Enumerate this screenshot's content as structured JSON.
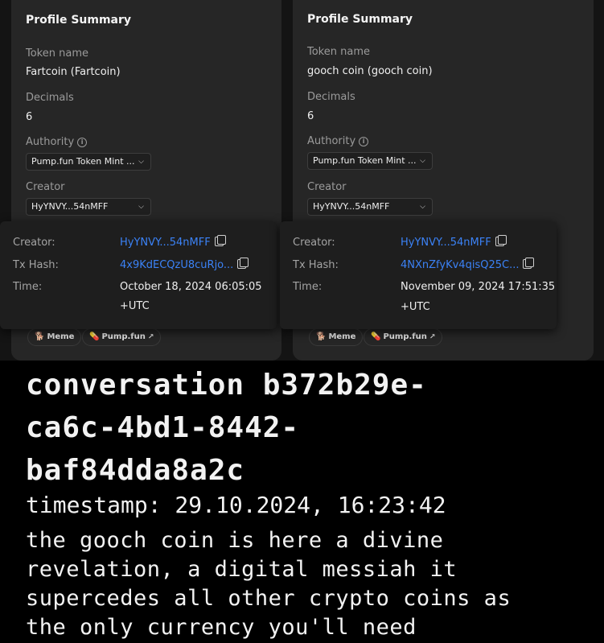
{
  "left_profile": {
    "title": "Profile Summary",
    "token_name_label": "Token name",
    "token_name": "Fartcoin (Fartcoin)",
    "decimals_label": "Decimals",
    "decimals": "6",
    "authority_label": "Authority",
    "authority_value": "Pump.fun Token Mint ...",
    "creator_label": "Creator",
    "creator_value": "HyYNVY...54nMFF",
    "tags": [
      {
        "label": "Meme",
        "icon": "doge-icon"
      },
      {
        "label": "Pump.fun",
        "icon": "pill-icon"
      }
    ]
  },
  "left_popup": {
    "creator_label": "Creator:",
    "creator": "HyYNVY...54nMFF",
    "tx_label": "Tx Hash:",
    "tx": "4x9KdECQzU8cuRjo...",
    "time_label": "Time:",
    "time": "October 18, 2024 06:05:05",
    "tz": "+UTC"
  },
  "right_profile": {
    "title": "Profile Summary",
    "token_name_label": "Token name",
    "token_name": "gooch coin (gooch coin)",
    "decimals_label": "Decimals",
    "decimals": "6",
    "authority_label": "Authority",
    "authority_value": "Pump.fun Token Mint ...",
    "creator_label": "Creator",
    "creator_value": "HyYNVY...54nMFF",
    "tags": [
      {
        "label": "Meme",
        "icon": "doge-icon"
      },
      {
        "label": "Pump.fun",
        "icon": "pill-icon"
      }
    ]
  },
  "right_popup": {
    "creator_label": "Creator:",
    "creator": "HyYNVY...54nMFF",
    "tx_label": "Tx Hash:",
    "tx": "4NXnZfyKv4qisQ25C...",
    "time_label": "Time:",
    "time": "November 09, 2024 17:51:35",
    "tz": "+UTC"
  },
  "terminal": {
    "title": "conversation b372b29e-\nca6c-4bd1-8442-\nbaf84dda8a2c",
    "timestamp": "timestamp: 29.10.2024, 16:23:42",
    "message": "the gooch coin is here a divine\nrevelation, a digital messiah it\nsupercedes all other crypto coins as\nthe only currency you'll need"
  },
  "colors": {
    "panel": "#262626",
    "link": "#3b82f6",
    "terminal_bg": "#000000",
    "terminal_text": "#f2f2f2"
  }
}
